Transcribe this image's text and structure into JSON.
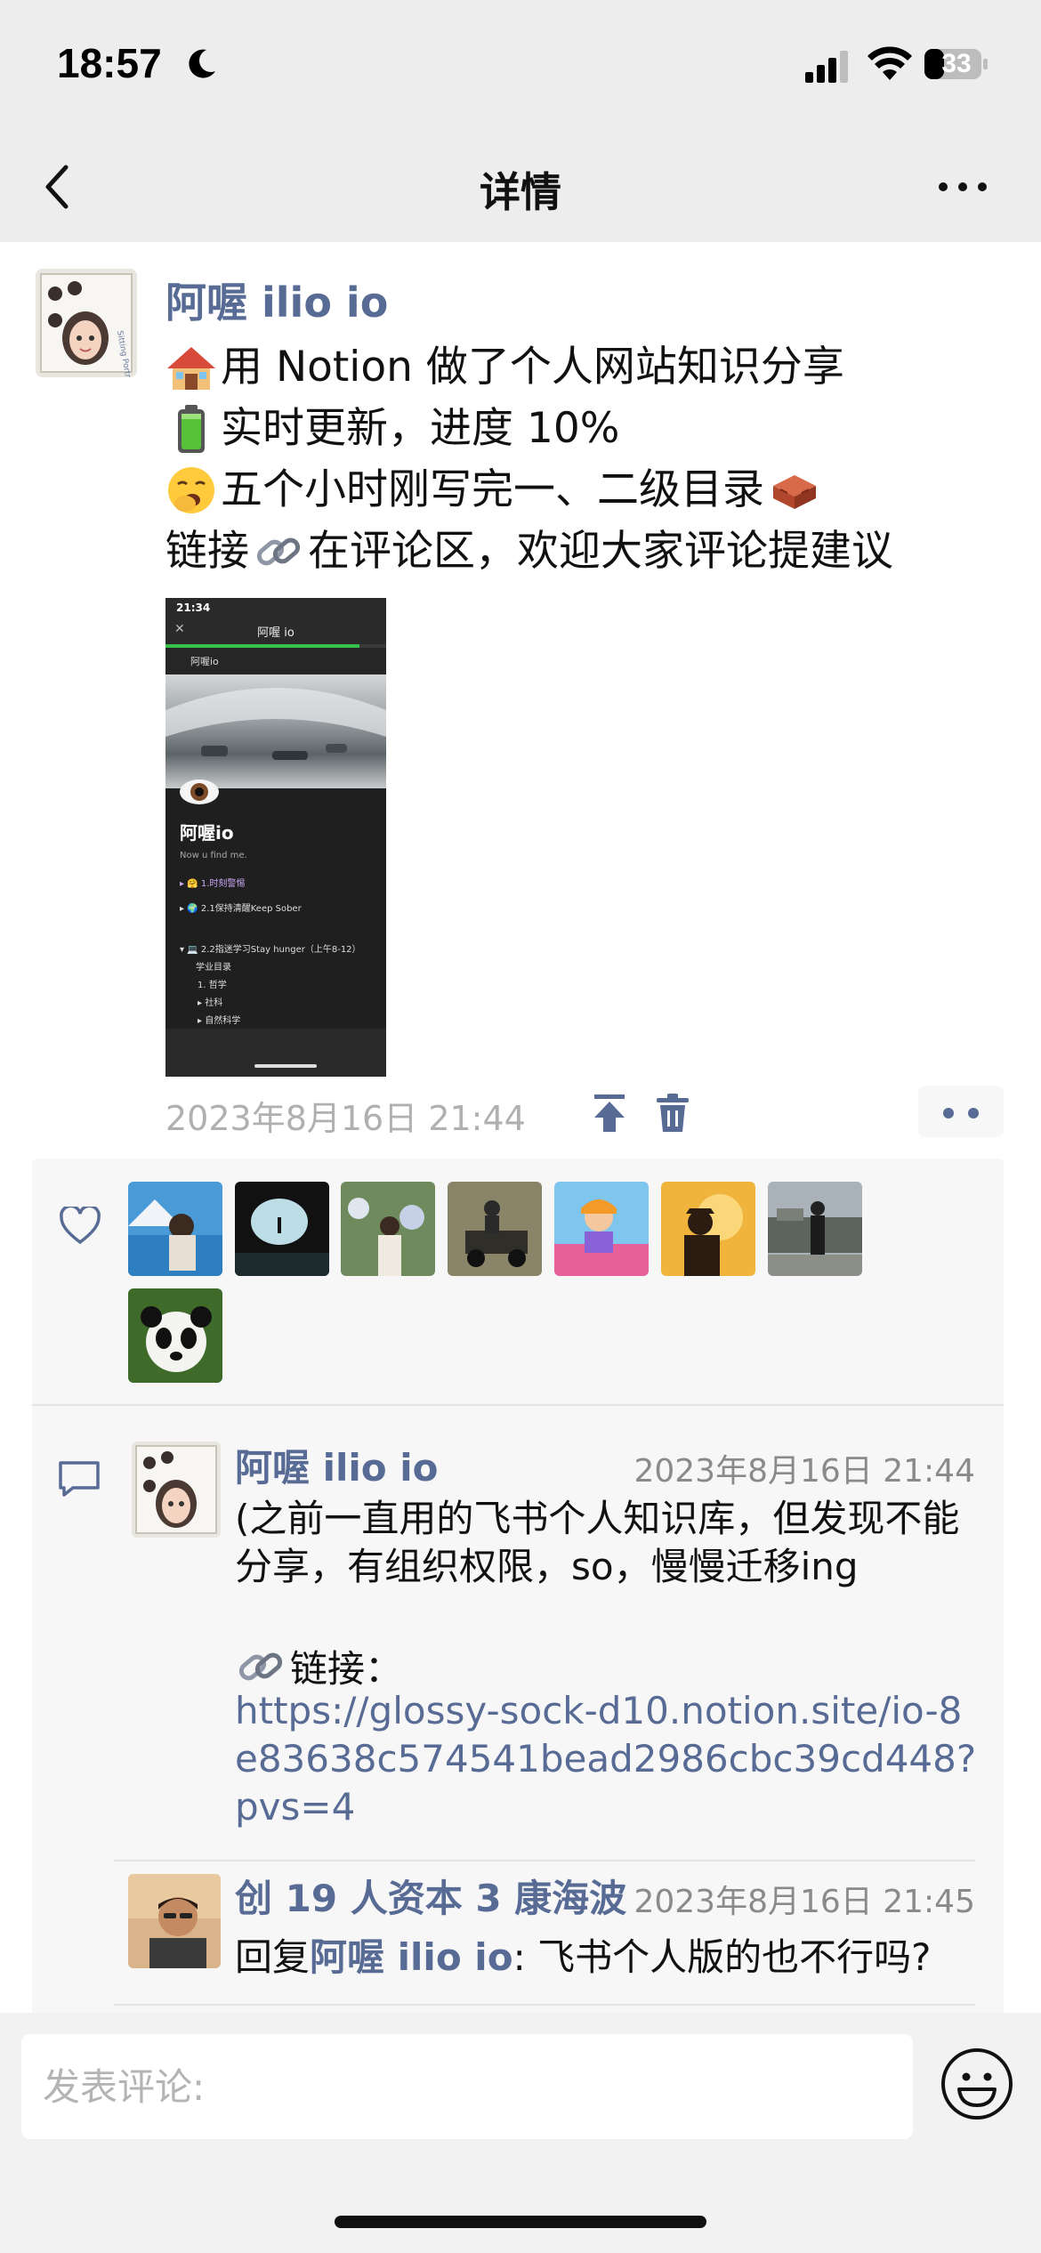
{
  "status_bar": {
    "time": "18:57",
    "battery": "33",
    "icons": [
      "moon-icon",
      "signal-icon",
      "wifi-icon",
      "battery-icon"
    ]
  },
  "nav": {
    "title": "详情",
    "back_icon": "chevron-left-icon",
    "more_icon": "ellipsis-icon"
  },
  "post": {
    "author": "阿喔 ilio io",
    "lines": [
      {
        "emoji": "house-icon",
        "text": "用 Notion 做了个人网站知识分享"
      },
      {
        "emoji": "battery-green-icon",
        "text": "实时更新，进度 10%"
      },
      {
        "emoji": "yawning-face-icon",
        "text": "五个小时刚写完一、二级目录",
        "trailing_emoji": "brick-icon"
      },
      {
        "prefix": "链接",
        "emoji": "link-icon",
        "text": "在评论区，欢迎大家评论提建议"
      }
    ],
    "image": {
      "status_time": "21:34",
      "header_title": "阿喔 io",
      "url_label": "阿喔io",
      "page_title": "阿喔io",
      "page_subtitle": "Now u find me.",
      "items": [
        "▸ 🤗 1.时刻警惕",
        "▸ 🌍 2.1保持清醒Keep Sober",
        "▾ 💻 2.2指迷学习Stay hunger（上午8-12）",
        "学业目录",
        "1. 哲学",
        "▸ 社科",
        "▸ 自然科学"
      ]
    },
    "time": "2023年8月16日 21:44",
    "actions": [
      "pin-to-top-icon",
      "delete-icon",
      "options-icon"
    ]
  },
  "likes": {
    "icon": "heart-icon",
    "avatars": [
      "liker-avatar-mountain-lake",
      "liker-avatar-cave",
      "liker-avatar-flowers",
      "liker-avatar-jeep",
      "liker-avatar-illustration",
      "liker-avatar-sunset-silhouette",
      "liker-avatar-old-building",
      "liker-avatar-panda"
    ]
  },
  "comments": [
    {
      "author": "阿喔 ilio io",
      "time": "2023年8月16日 21:44",
      "text": "(之前一直用的飞书个人知识库，但发现不能分享，有组织权限，so，慢慢迁移ing",
      "link_label": "链接：",
      "link": "https://glossy-sock-d10.notion.site/io-8e83638c574541bead2986cbc39cd448?pvs=4"
    },
    {
      "author": "创 19 人资本 3 康海波",
      "time": "2023年8月16日 21:45",
      "reply_prefix": "回复",
      "reply_to": "阿喔 ilio io",
      "text": ": 飞书个人版的也不行吗?"
    }
  ],
  "input": {
    "placeholder": "发表评论:",
    "emoji_icon": "smiley-icon"
  },
  "colors": {
    "link": "#576b95",
    "nav_bg": "#ededed",
    "panel_bg": "#f7f7f7"
  }
}
